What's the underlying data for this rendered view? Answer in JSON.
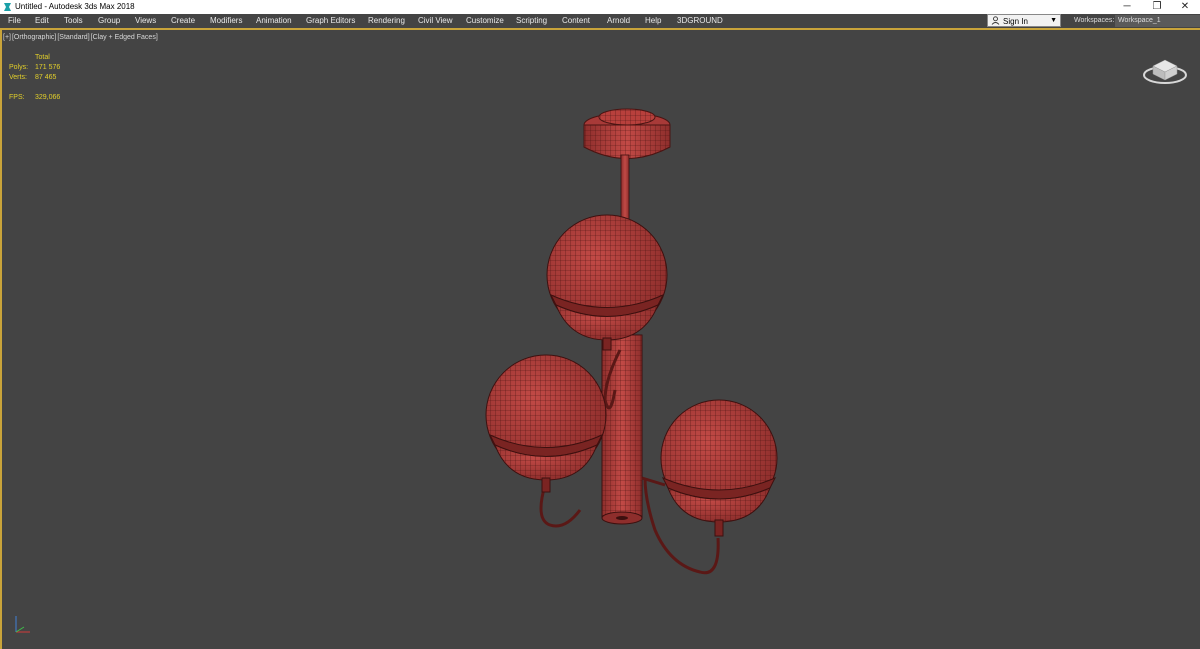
{
  "window": {
    "title": "Untitled - Autodesk 3ds Max 2018",
    "minimize_glyph": "─",
    "restore_glyph": "❐",
    "close_glyph": "✕"
  },
  "menu": {
    "items": [
      "File",
      "Edit",
      "Tools",
      "Group",
      "Views",
      "Create",
      "Modifiers",
      "Animation",
      "Graph Editors",
      "Rendering",
      "Civil View",
      "Customize",
      "Scripting",
      "Content",
      "Arnold",
      "Help",
      "3DGROUND"
    ]
  },
  "account": {
    "signin_label": "Sign In",
    "caret": "▼"
  },
  "workspace": {
    "label": "Workspaces:",
    "value": "Workspace_1"
  },
  "viewport": {
    "labels": [
      "[+]",
      "[Orthographic]",
      "[Standard]",
      "[Clay + Edged Faces]"
    ],
    "stats": {
      "header": "Total",
      "polys_label": "Polys:",
      "polys_value": "171 576",
      "verts_label": "Verts:",
      "verts_value": "87 465",
      "fps_label": "FPS:",
      "fps_value": "329,066"
    },
    "model_color": "#a83a38",
    "wire_color": "#4a1412"
  },
  "colors": {
    "accent_gold": "#c9a43a",
    "stats_yellow": "#e3d02a",
    "viewport_bg": "#444444"
  }
}
